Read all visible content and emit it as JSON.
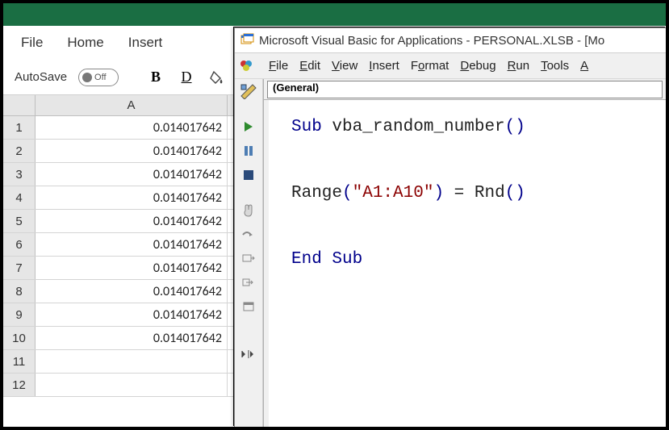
{
  "excel": {
    "tabs": {
      "file": "File",
      "home": "Home",
      "insert": "Insert"
    },
    "autosave_label": "AutoSave",
    "autosave_state": "Off",
    "toolbar": {
      "bold": "B",
      "underline": "D"
    },
    "column_header": "A",
    "rows": [
      {
        "num": "1",
        "val": "0.014017642"
      },
      {
        "num": "2",
        "val": "0.014017642"
      },
      {
        "num": "3",
        "val": "0.014017642"
      },
      {
        "num": "4",
        "val": "0.014017642"
      },
      {
        "num": "5",
        "val": "0.014017642"
      },
      {
        "num": "6",
        "val": "0.014017642"
      },
      {
        "num": "7",
        "val": "0.014017642"
      },
      {
        "num": "8",
        "val": "0.014017642"
      },
      {
        "num": "9",
        "val": "0.014017642"
      },
      {
        "num": "10",
        "val": "0.014017642"
      },
      {
        "num": "11",
        "val": ""
      },
      {
        "num": "12",
        "val": ""
      }
    ]
  },
  "vbe": {
    "title": "Microsoft Visual Basic for Applications - PERSONAL.XLSB - [Mo",
    "menus": {
      "file": "File",
      "edit": "Edit",
      "view": "View",
      "insert": "Insert",
      "format": "Format",
      "debug": "Debug",
      "run": "Run",
      "tools": "Tools",
      "a": "A"
    },
    "dropdown": "(General)",
    "code": {
      "sub_kw": "Sub",
      "sub_name": "vba_random_number",
      "range_fn": "Range",
      "range_arg": "\"A1:A10\"",
      "eq": " = ",
      "rnd_fn": "Rnd",
      "end_sub": "End Sub"
    }
  }
}
